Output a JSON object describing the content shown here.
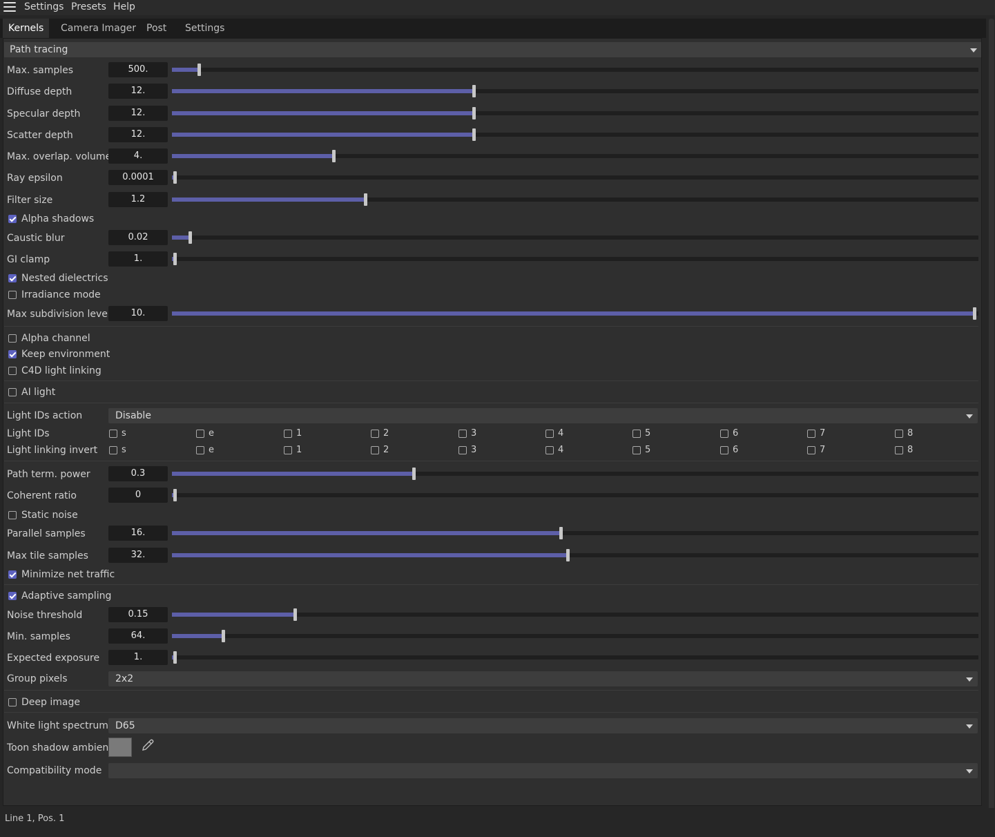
{
  "menu": [
    "Settings",
    "Presets",
    "Help"
  ],
  "tabs": [
    {
      "label": "Kernels",
      "active": true
    },
    {
      "label": "Camera Imager",
      "active": false
    },
    {
      "label": "Post",
      "active": false
    },
    {
      "label": "Settings",
      "active": false
    }
  ],
  "kernel_type": "Path tracing",
  "sliders": [
    {
      "label": "Max. samples",
      "value": "500.",
      "fraction": 0.033
    },
    {
      "label": "Diffuse depth",
      "value": "12.",
      "fraction": 0.374
    },
    {
      "label": "Specular depth",
      "value": "12.",
      "fraction": 0.374
    },
    {
      "label": "Scatter depth",
      "value": "12.",
      "fraction": 0.374
    },
    {
      "label": "Max. overlap. volumes",
      "value": "4.",
      "fraction": 0.2
    },
    {
      "label": "Ray epsilon",
      "value": "0.0001",
      "fraction": 0.003
    },
    {
      "label": "Filter size",
      "value": "1.2",
      "fraction": 0.24
    },
    {
      "label": "Caustic blur",
      "value": "0.02",
      "fraction": 0.022
    },
    {
      "label": "GI clamp",
      "value": "1.",
      "fraction": 0.003
    },
    {
      "label": "Max subdivision level",
      "value": "10.",
      "fraction": 0.995
    },
    {
      "label": "Path term. power",
      "value": "0.3",
      "fraction": 0.3
    },
    {
      "label": "Coherent ratio",
      "value": "0",
      "fraction": 0.003
    },
    {
      "label": "Parallel samples",
      "value": "16.",
      "fraction": 0.482
    },
    {
      "label": "Max tile samples",
      "value": "32.",
      "fraction": 0.491
    },
    {
      "label": "Noise threshold",
      "value": "0.15",
      "fraction": 0.152
    },
    {
      "label": "Min. samples",
      "value": "64.",
      "fraction": 0.063
    },
    {
      "label": "Expected exposure",
      "value": "1.",
      "fraction": 0.003
    }
  ],
  "checkboxes": [
    {
      "label": "Alpha shadows",
      "checked": true
    },
    {
      "label": "Nested dielectrics",
      "checked": true
    },
    {
      "label": "Irradiance mode",
      "checked": false
    },
    {
      "label": "Alpha channel",
      "checked": false
    },
    {
      "label": "Keep environment",
      "checked": true
    },
    {
      "label": "C4D light linking",
      "checked": false
    },
    {
      "label": "AI light",
      "checked": false
    },
    {
      "label": "Static noise",
      "checked": false
    },
    {
      "label": "Minimize net traffic",
      "checked": true
    },
    {
      "label": "Adaptive sampling",
      "checked": true
    },
    {
      "label": "Deep image",
      "checked": false
    }
  ],
  "light_ids_action": {
    "label": "Light IDs action",
    "value": "Disable"
  },
  "light_ids": {
    "label": "Light IDs",
    "options": [
      "s",
      "e",
      "1",
      "2",
      "3",
      "4",
      "5",
      "6",
      "7",
      "8"
    ]
  },
  "light_linking_invert": {
    "label": "Light linking invert",
    "options": [
      "s",
      "e",
      "1",
      "2",
      "3",
      "4",
      "5",
      "6",
      "7",
      "8"
    ]
  },
  "group_pixels": {
    "label": "Group pixels",
    "value": "2x2"
  },
  "white_light_spectrum": {
    "label": "White light spectrum",
    "value": "D65"
  },
  "toon_shadow_ambient": {
    "label": "Toon shadow ambient",
    "color": "#7a7a7a"
  },
  "compatibility_mode": {
    "label": "Compatibility mode",
    "value": ""
  },
  "status": "Line 1, Pos. 1"
}
